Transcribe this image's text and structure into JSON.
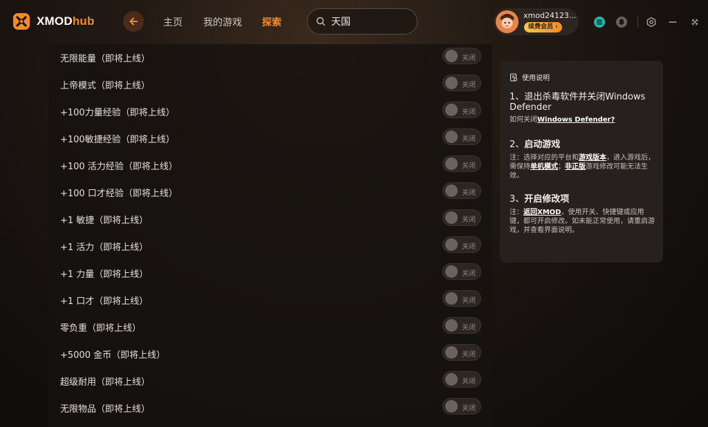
{
  "app": {
    "logo_main": "XMOD",
    "logo_hub": "hub"
  },
  "nav": {
    "home": "主页",
    "my_games": "我的游戏",
    "explore": "探索"
  },
  "search": {
    "value": "天国"
  },
  "user": {
    "name": "xmod24123...",
    "vip_label": "续费会员 ›"
  },
  "toggle_off_label": "关闭",
  "mods": [
    {
      "label": "无限能量（即将上线）",
      "state": "关闭"
    },
    {
      "label": "上帝模式（即将上线）",
      "state": "关闭"
    },
    {
      "label": "+100力量经验（即将上线）",
      "state": "关闭"
    },
    {
      "label": "+100敏捷经验（即将上线）",
      "state": "关闭"
    },
    {
      "label": "+100 活力经验（即将上线）",
      "state": "关闭"
    },
    {
      "label": "+100 口才经验（即将上线）",
      "state": "关闭"
    },
    {
      "label": "+1 敏捷（即将上线）",
      "state": "关闭"
    },
    {
      "label": "+1 活力（即将上线）",
      "state": "关闭"
    },
    {
      "label": "+1 力量（即将上线）",
      "state": "关闭"
    },
    {
      "label": "+1 口才（即将上线）",
      "state": "关闭"
    },
    {
      "label": "零负重（即将上线）",
      "state": "关闭"
    },
    {
      "label": "+5000 金币（即将上线）",
      "state": "关闭"
    },
    {
      "label": "超级耐用（即将上线）",
      "state": "关闭"
    },
    {
      "label": "无限物品（即将上线）",
      "state": "关闭"
    }
  ],
  "instructions": {
    "heading": "使用说明",
    "step1_title": "1、退出杀毒软件并关闭Windows Defender",
    "step1_note_prefix": "如何关闭",
    "step1_note_link": "Windows Defender?",
    "step2_num": "2、",
    "step2_title": "启动游戏",
    "step2_note": {
      "a": "注：选择对应的平台和",
      "link1": "游戏版本",
      "b": "，进入游戏后，需保持",
      "link2": "单机模式",
      "c": "；",
      "link3": "非正版",
      "d": "游戏修改可能无法生效。"
    },
    "step3_num": "3、",
    "step3_title": "开启修改项",
    "step3_note": {
      "a": "注：",
      "link1": "返回XMOD",
      "b": "，使用开关、快捷键或应用键，都可开启修改。如未能正常使用，请重启游戏，并查看界面说明。"
    }
  },
  "colors": {
    "accent": "#f28c28",
    "panel_bg": "#16120f",
    "card_bg": "#28221f"
  },
  "icons": [
    "logo-icon",
    "back-arrow-icon",
    "search-icon",
    "app-icon",
    "notification-icon",
    "settings-icon",
    "minimize-icon",
    "close-icon",
    "document-icon"
  ]
}
